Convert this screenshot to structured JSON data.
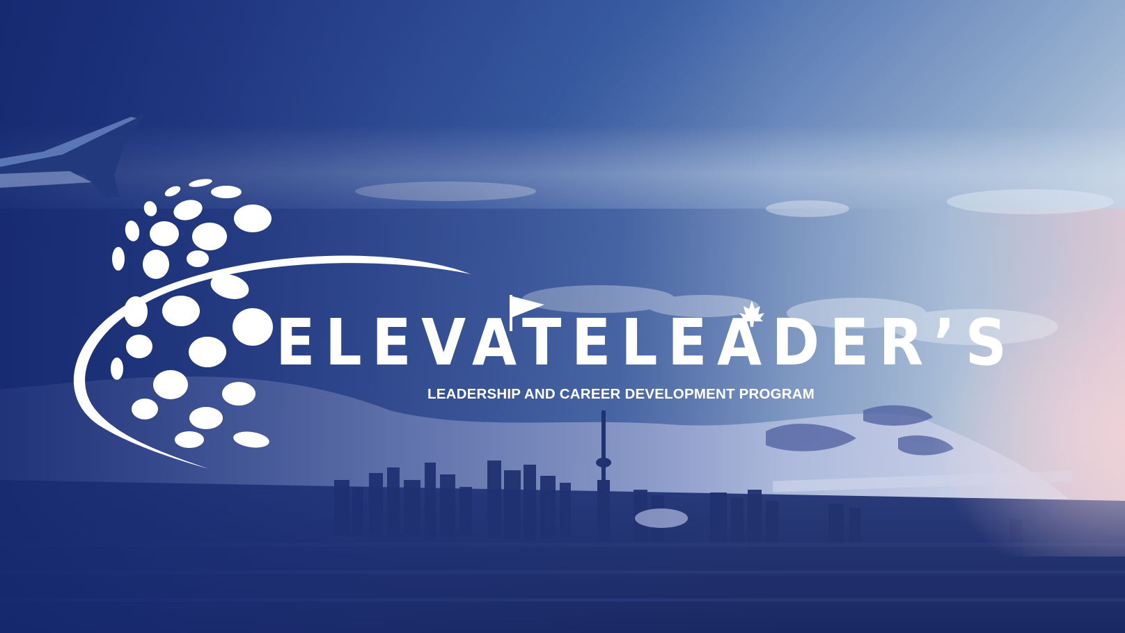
{
  "brand": {
    "title": "ELEVATELEADER’S",
    "tagline": "LEADERSHIP AND CAREER DEVELOPMENT PROGRAM"
  },
  "colors": {
    "overlay_dark": "#1b2e7a",
    "overlay_mid": "#3f5fa6",
    "sky_light": "#d8e2ee",
    "sunset_glow": "#e9cfd6",
    "logo": "#ffffff"
  },
  "icons": [
    "globe-dots-icon",
    "orbit-swoosh-icon",
    "golf-flag-icon",
    "maple-leaf-icon"
  ],
  "background": {
    "scene": "aerial-city-skyline-with-lake-and-airplane-wing"
  }
}
